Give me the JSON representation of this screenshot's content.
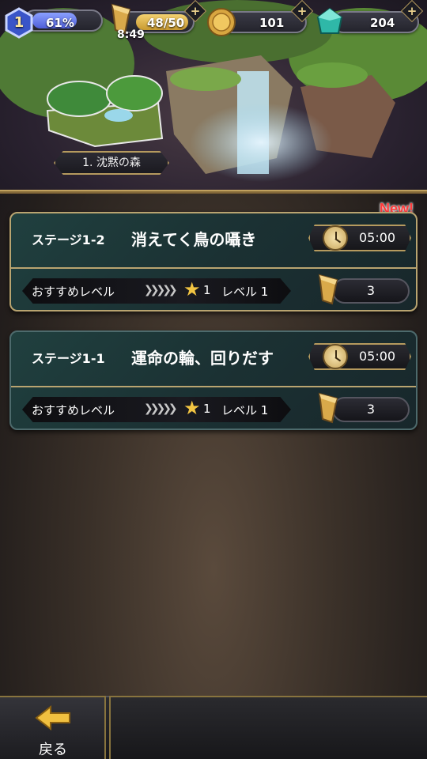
{
  "hud": {
    "player_level": "1",
    "exp_percent": "61%",
    "stamina": "48/50",
    "stamina_timer": "8:49",
    "coins": "101",
    "gems": "204"
  },
  "area": {
    "name": "1. 沈黙の森"
  },
  "stages": [
    {
      "number": "ステージ1-2",
      "title": "消えてく鳥の囁き",
      "time": "05:00",
      "rec_label": "おすすめレベル",
      "stars": "1",
      "level": "レベル 1",
      "cost": "3",
      "badge": "New!"
    },
    {
      "number": "ステージ1-1",
      "title": "運命の輪、回りだす",
      "time": "05:00",
      "rec_label": "おすすめレベル",
      "stars": "1",
      "level": "レベル 1",
      "cost": "3"
    }
  ],
  "nav": {
    "back_label": "戻る"
  }
}
